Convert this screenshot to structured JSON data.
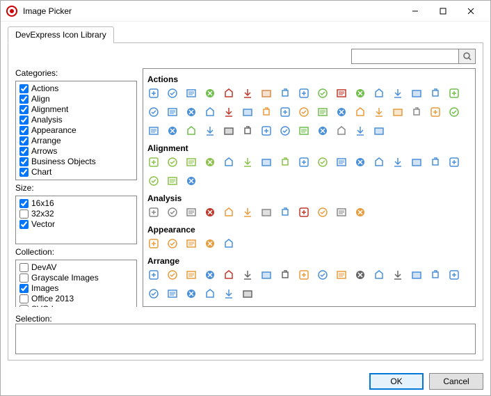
{
  "window": {
    "title": "Image Picker"
  },
  "tabs": [
    {
      "label": "DevExpress Icon Library"
    }
  ],
  "search": {
    "value": ""
  },
  "labels": {
    "categories": "Categories:",
    "size": "Size:",
    "collection": "Collection:",
    "selection": "Selection:"
  },
  "categories": [
    {
      "label": "Actions",
      "checked": true
    },
    {
      "label": "Align",
      "checked": true
    },
    {
      "label": "Alignment",
      "checked": true
    },
    {
      "label": "Analysis",
      "checked": true
    },
    {
      "label": "Appearance",
      "checked": true
    },
    {
      "label": "Arrange",
      "checked": true
    },
    {
      "label": "Arrows",
      "checked": true
    },
    {
      "label": "Business Objects",
      "checked": true
    },
    {
      "label": "Chart",
      "checked": true
    }
  ],
  "sizes": [
    {
      "label": "16x16",
      "checked": true
    },
    {
      "label": "32x32",
      "checked": false
    },
    {
      "label": "Vector",
      "checked": true
    }
  ],
  "collections": [
    {
      "label": "DevAV",
      "checked": false
    },
    {
      "label": "Grayscale Images",
      "checked": false
    },
    {
      "label": "Images",
      "checked": true
    },
    {
      "label": "Office 2013",
      "checked": false
    },
    {
      "label": "SVG Images",
      "checked": false
    }
  ],
  "iconGroups": [
    {
      "name": "Actions",
      "icons": [
        {
          "id": "add",
          "c": "#4a90d9"
        },
        {
          "id": "add-file",
          "c": "#4a90d9"
        },
        {
          "id": "add-item",
          "c": "#4a90d9"
        },
        {
          "id": "apply",
          "c": "#6fbf4a"
        },
        {
          "id": "bookmark",
          "c": "#c0392b"
        },
        {
          "id": "cancel",
          "c": "#c0392b"
        },
        {
          "id": "clear",
          "c": "#d98b4a"
        },
        {
          "id": "clear-format",
          "c": "#4a90d9"
        },
        {
          "id": "clip",
          "c": "#4a90d9"
        },
        {
          "id": "close",
          "c": "#6fbf4a"
        },
        {
          "id": "close2",
          "c": "#c0392b"
        },
        {
          "id": "convert",
          "c": "#6fbf4a"
        },
        {
          "id": "copy",
          "c": "#4a90d9"
        },
        {
          "id": "cut",
          "c": "#4a90d9"
        },
        {
          "id": "doc",
          "c": "#4a90d9"
        },
        {
          "id": "download",
          "c": "#4a90d9"
        },
        {
          "id": "drop",
          "c": "#6fbf4a"
        },
        {
          "id": "ab",
          "c": "#4a90d9"
        },
        {
          "id": "down",
          "c": "#4a90d9"
        },
        {
          "id": "edit",
          "c": "#4a90d9"
        },
        {
          "id": "edit2",
          "c": "#4a90d9"
        },
        {
          "id": "erase",
          "c": "#c0392b"
        },
        {
          "id": "form",
          "c": "#4a90d9"
        },
        {
          "id": "form2",
          "c": "#e89c3c"
        },
        {
          "id": "grid",
          "c": "#4a90d9"
        },
        {
          "id": "group",
          "c": "#e89c3c"
        },
        {
          "id": "merge",
          "c": "#6fbf4a"
        },
        {
          "id": "new",
          "c": "#4a90d9"
        },
        {
          "id": "open",
          "c": "#e89c3c"
        },
        {
          "id": "open2",
          "c": "#e89c3c"
        },
        {
          "id": "open3",
          "c": "#e89c3c"
        },
        {
          "id": "book",
          "c": "#888888"
        },
        {
          "id": "paste",
          "c": "#e89c3c"
        },
        {
          "id": "redo",
          "c": "#6fbf4a"
        },
        {
          "id": "remove",
          "c": "#4a90d9"
        },
        {
          "id": "undo",
          "c": "#4a90d9"
        },
        {
          "id": "refresh",
          "c": "#6fbf4a"
        },
        {
          "id": "next",
          "c": "#4a90d9"
        },
        {
          "id": "select",
          "c": "#666666"
        },
        {
          "id": "select2",
          "c": "#666666"
        },
        {
          "id": "show",
          "c": "#4a90d9"
        },
        {
          "id": "show2",
          "c": "#4a90d9"
        },
        {
          "id": "split",
          "c": "#6fbf4a"
        },
        {
          "id": "squeeze",
          "c": "#4a90d9"
        },
        {
          "id": "trash",
          "c": "#888888"
        },
        {
          "id": "upload",
          "c": "#4a90d9"
        },
        {
          "id": "up",
          "c": "#4a90d9"
        }
      ]
    },
    {
      "name": "Alignment",
      "icons": [
        {
          "id": "al1",
          "c": "#8bc34a"
        },
        {
          "id": "al2",
          "c": "#8bc34a"
        },
        {
          "id": "al3",
          "c": "#8bc34a"
        },
        {
          "id": "al4",
          "c": "#8bc34a"
        },
        {
          "id": "al5",
          "c": "#4a90d9"
        },
        {
          "id": "al6",
          "c": "#8bc34a"
        },
        {
          "id": "al7",
          "c": "#4a90d9"
        },
        {
          "id": "al8",
          "c": "#8bc34a"
        },
        {
          "id": "al9",
          "c": "#4a90d9"
        },
        {
          "id": "al10",
          "c": "#8bc34a"
        },
        {
          "id": "al11",
          "c": "#4a90d9"
        },
        {
          "id": "al12",
          "c": "#4a90d9"
        },
        {
          "id": "al13",
          "c": "#4a90d9"
        },
        {
          "id": "al14",
          "c": "#4a90d9"
        },
        {
          "id": "al15",
          "c": "#4a90d9"
        },
        {
          "id": "al16",
          "c": "#4a90d9"
        },
        {
          "id": "al17",
          "c": "#4a90d9"
        },
        {
          "id": "al18",
          "c": "#8bc34a"
        },
        {
          "id": "al19",
          "c": "#8bc34a"
        },
        {
          "id": "al20",
          "c": "#4a90d9"
        }
      ]
    },
    {
      "name": "Analysis",
      "icons": [
        {
          "id": "an1",
          "c": "#888888"
        },
        {
          "id": "an2",
          "c": "#888888"
        },
        {
          "id": "an3",
          "c": "#888888"
        },
        {
          "id": "an4",
          "c": "#c0392b"
        },
        {
          "id": "an5",
          "c": "#e89c3c"
        },
        {
          "id": "an6",
          "c": "#e89c3c"
        },
        {
          "id": "an7",
          "c": "#888888"
        },
        {
          "id": "an8",
          "c": "#4a90d9"
        },
        {
          "id": "an9",
          "c": "#c0392b"
        },
        {
          "id": "an10",
          "c": "#e89c3c"
        },
        {
          "id": "an11",
          "c": "#888888"
        },
        {
          "id": "an12",
          "c": "#e89c3c"
        }
      ]
    },
    {
      "name": "Appearance",
      "icons": [
        {
          "id": "ap1",
          "c": "#e89c3c"
        },
        {
          "id": "ap2",
          "c": "#e89c3c"
        },
        {
          "id": "ap3",
          "c": "#e89c3c"
        },
        {
          "id": "ap4",
          "c": "#e89c3c"
        },
        {
          "id": "ap5",
          "c": "#4a90d9"
        }
      ]
    },
    {
      "name": "Arrange",
      "icons": [
        {
          "id": "ar1",
          "c": "#4a90d9"
        },
        {
          "id": "ar2",
          "c": "#e89c3c"
        },
        {
          "id": "ar3",
          "c": "#e89c3c"
        },
        {
          "id": "ar4",
          "c": "#4a90d9"
        },
        {
          "id": "ar5",
          "c": "#c0392b"
        },
        {
          "id": "ar6",
          "c": "#666666"
        },
        {
          "id": "ar7",
          "c": "#4a90d9"
        },
        {
          "id": "ar8",
          "c": "#666666"
        },
        {
          "id": "ar9",
          "c": "#e89c3c"
        },
        {
          "id": "ar10",
          "c": "#4a90d9"
        },
        {
          "id": "ar11",
          "c": "#e89c3c"
        },
        {
          "id": "ar12",
          "c": "#666666"
        },
        {
          "id": "ar13",
          "c": "#4a90d9"
        },
        {
          "id": "ar14",
          "c": "#666666"
        },
        {
          "id": "ar15",
          "c": "#4a90d9"
        },
        {
          "id": "ar16",
          "c": "#4a90d9"
        },
        {
          "id": "ar17",
          "c": "#4a90d9"
        },
        {
          "id": "ar18",
          "c": "#4a90d9"
        },
        {
          "id": "ar19",
          "c": "#4a90d9"
        },
        {
          "id": "ar20",
          "c": "#4a90d9"
        },
        {
          "id": "ar21",
          "c": "#4a90d9"
        },
        {
          "id": "ar22",
          "c": "#4a90d9"
        },
        {
          "id": "ar23",
          "c": "#666666"
        }
      ]
    }
  ],
  "buttons": {
    "ok": "OK",
    "cancel": "Cancel"
  }
}
